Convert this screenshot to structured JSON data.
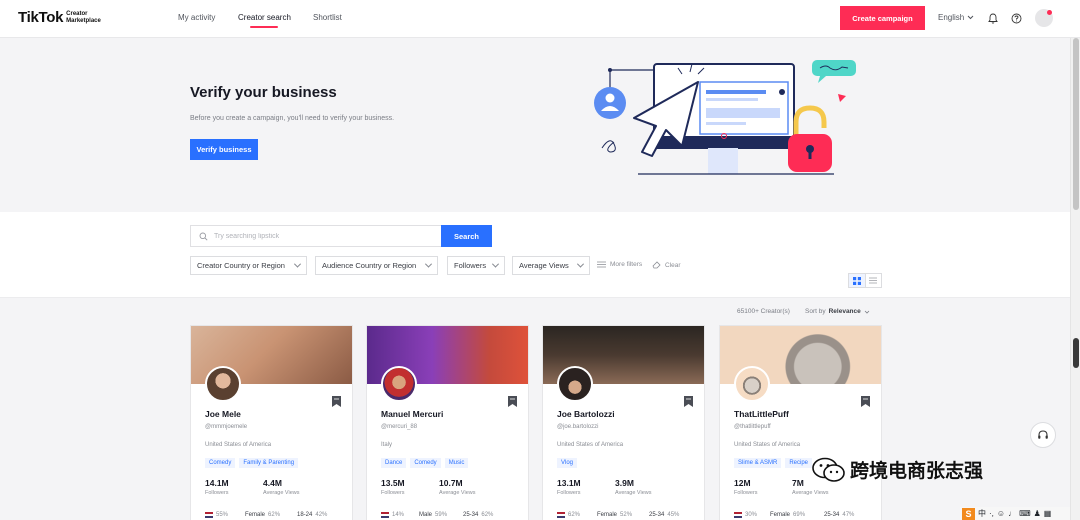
{
  "header": {
    "logo_main": "TikTok",
    "logo_sub": "Creator Marketplace",
    "nav": [
      {
        "label": "My activity"
      },
      {
        "label": "Creator search"
      },
      {
        "label": "Shortlist"
      }
    ],
    "create_campaign": "Create campaign",
    "language": "English"
  },
  "hero": {
    "title": "Verify your business",
    "description": "Before you create a campaign, you'll need to verify your business.",
    "button": "Verify business"
  },
  "search": {
    "placeholder": "Try searching lipstick",
    "button": "Search",
    "filters": [
      {
        "label": "Creator Country or Region"
      },
      {
        "label": "Audience Country or Region"
      },
      {
        "label": "Followers"
      },
      {
        "label": "Average Views"
      }
    ],
    "more_filters": "More filters",
    "clear": "Clear"
  },
  "results": {
    "count": "65100+ Creator(s)",
    "sort_prefix": "Sort by",
    "sort_value": "Relevance"
  },
  "creators": [
    {
      "name": "Joe Mele",
      "handle": "@mmmjoemele",
      "country": "United States of America",
      "tags": [
        "Comedy",
        "Family & Parenting"
      ],
      "followers": "14.1M",
      "followers_label": "Followers",
      "avg_views": "4.4M",
      "avg_views_label": "Average Views",
      "aud_country_pct": "55%",
      "aud_gender": "Female",
      "aud_gender_pct": "62%",
      "aud_age": "18-24",
      "aud_age_pct": "42%"
    },
    {
      "name": "Manuel Mercuri",
      "handle": "@mercuri_88",
      "country": "Italy",
      "tags": [
        "Dance",
        "Comedy",
        "Music"
      ],
      "followers": "13.5M",
      "followers_label": "Followers",
      "avg_views": "10.7M",
      "avg_views_label": "Average Views",
      "aud_country_pct": "14%",
      "aud_gender": "Male",
      "aud_gender_pct": "59%",
      "aud_age": "25-34",
      "aud_age_pct": "62%"
    },
    {
      "name": "Joe Bartolozzi",
      "handle": "@joe.bartolozzi",
      "country": "United States of America",
      "tags": [
        "Vlog"
      ],
      "followers": "13.1M",
      "followers_label": "Followers",
      "avg_views": "3.9M",
      "avg_views_label": "Average Views",
      "aud_country_pct": "62%",
      "aud_gender": "Female",
      "aud_gender_pct": "52%",
      "aud_age": "25-34",
      "aud_age_pct": "45%"
    },
    {
      "name": "ThatLittlePuff",
      "handle": "@thatlittlepuff",
      "country": "United States of America",
      "tags": [
        "Slime & ASMR",
        "Recipe"
      ],
      "followers": "12M",
      "followers_label": "Followers",
      "avg_views": "7M",
      "avg_views_label": "Average Views",
      "aud_country_pct": "30%",
      "aud_gender": "Female",
      "aud_gender_pct": "69%",
      "aud_age": "25-34",
      "aud_age_pct": "47%"
    }
  ],
  "watermark": "跨境电商张志强",
  "ime": {
    "logo": "S",
    "text": "中"
  },
  "colors": {
    "brand_pink": "#fe2c55",
    "accent_blue": "#2970ff"
  }
}
